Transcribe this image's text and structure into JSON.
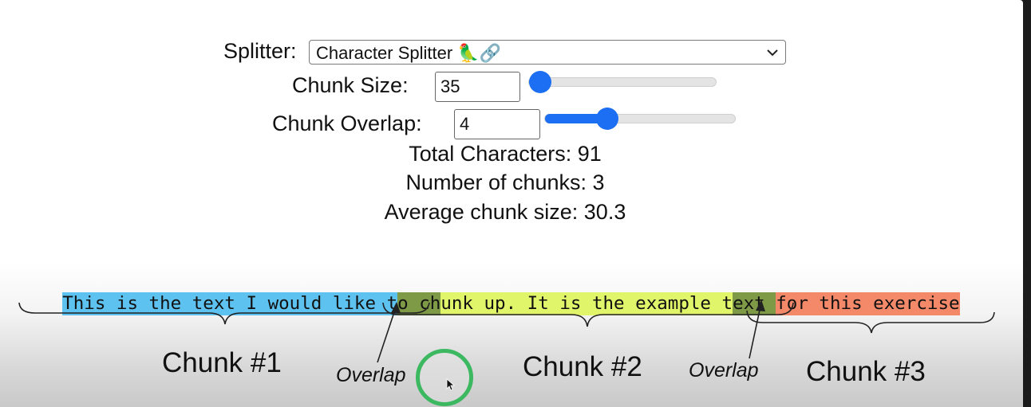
{
  "controls": {
    "splitter_label": "Splitter:",
    "splitter_value": "Character Splitter 🦜🔗",
    "chunk_size_label": "Chunk Size:",
    "chunk_size_value": "35",
    "chunk_overlap_label": "Chunk Overlap:",
    "chunk_overlap_value": "4",
    "chunk_size_slider_fraction": 0.0,
    "chunk_overlap_slider_fraction": 0.3
  },
  "stats": {
    "total_characters": "Total Characters: 91",
    "number_of_chunks": "Number of chunks: 3",
    "average_chunk_size": "Average chunk size: 30.3"
  },
  "chunked_text": {
    "segments": [
      {
        "text": "This is the text I would like t",
        "kind": "chunk1",
        "color": "#5ec2f0"
      },
      {
        "text": "o ch",
        "kind": "overlap",
        "color": "#7f9a47"
      },
      {
        "text": "unk up. It is the example t",
        "kind": "chunk2",
        "color": "#e1f56a"
      },
      {
        "text": "ext ",
        "kind": "overlap",
        "color": "#7f9a47"
      },
      {
        "text": "for this exercise",
        "kind": "chunk3",
        "color": "#f4896a"
      }
    ]
  },
  "annotations": {
    "chunk1": "Chunk #1",
    "chunk2": "Chunk #2",
    "chunk3": "Chunk #3",
    "overlap1": "Overlap",
    "overlap2": "Overlap"
  },
  "colors": {
    "slider_accent": "#1c6ef2",
    "click_ring": "#3cb861"
  }
}
